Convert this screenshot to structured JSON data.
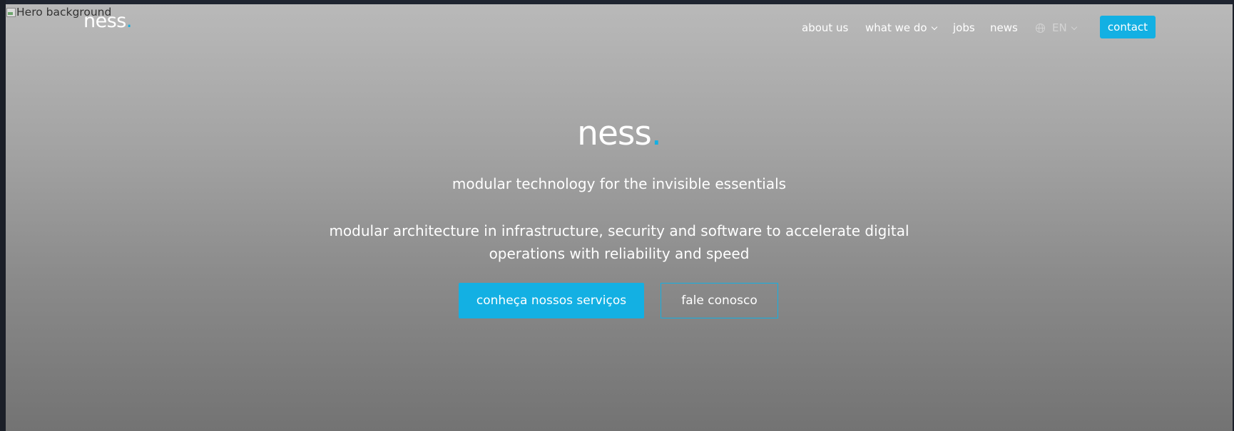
{
  "hero": {
    "alt_text": "Hero background",
    "logo_text": "ness",
    "logo_dot": ".",
    "tagline": "modular technology for the invisible essentials",
    "description": "modular architecture in infrastructure, security and software to accelerate digital operations with reliability and speed",
    "primary_button": "conheça nossos serviços",
    "secondary_button": "fale conosco"
  },
  "header": {
    "logo_text": "ness",
    "logo_dot": ".",
    "nav": {
      "about": "about us",
      "what_we_do": "what we do",
      "jobs": "jobs",
      "news": "news",
      "language": "EN",
      "contact": "contact"
    }
  },
  "colors": {
    "accent": "#13b0e3"
  }
}
